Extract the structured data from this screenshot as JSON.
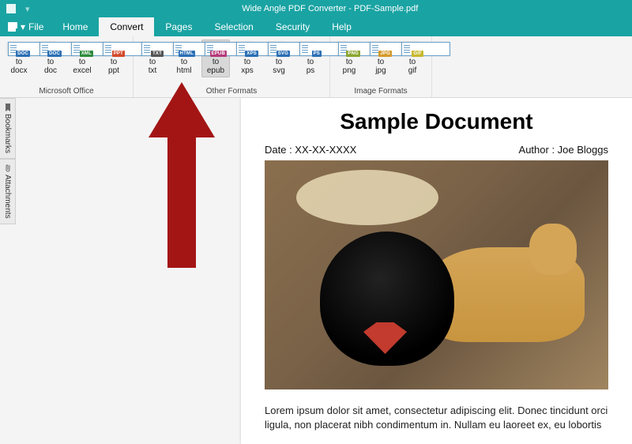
{
  "titlebar": {
    "app_icon": "app-icon",
    "title": "Wide Angle PDF Converter - PDF-Sample.pdf"
  },
  "menubar": {
    "file_label": "File",
    "tabs": [
      {
        "label": "Home"
      },
      {
        "label": "Convert",
        "active": true
      },
      {
        "label": "Pages"
      },
      {
        "label": "Selection"
      },
      {
        "label": "Security"
      },
      {
        "label": "Help"
      }
    ]
  },
  "ribbon": {
    "groups": [
      {
        "label": "Microsoft Office",
        "buttons": [
          {
            "label": "to\ndocx",
            "badge_text": "DOC",
            "badge_color": "#2b6fb5"
          },
          {
            "label": "to\ndoc",
            "badge_text": "DOC",
            "badge_color": "#2b6fb5"
          },
          {
            "label": "to\nexcel",
            "badge_text": "XML",
            "badge_color": "#2e8b3d"
          },
          {
            "label": "to\nppt",
            "badge_text": "PPT",
            "badge_color": "#d24a2b"
          }
        ]
      },
      {
        "label": "Other Formats",
        "buttons": [
          {
            "label": "to\ntxt",
            "badge_text": "TXT",
            "badge_color": "#555"
          },
          {
            "label": "to\nhtml",
            "badge_text": "HTML",
            "badge_color": "#2b6fb5"
          },
          {
            "label": "to\nepub",
            "badge_text": "EPUB",
            "badge_color": "#b53a7a",
            "active": true
          },
          {
            "label": "to\nxps",
            "badge_text": "XPS",
            "badge_color": "#2b6fb5"
          },
          {
            "label": "to\nsvg",
            "badge_text": "SVG",
            "badge_color": "#2b6fb5"
          },
          {
            "label": "to\nps",
            "badge_text": "PS",
            "badge_color": "#2b6fb5"
          }
        ]
      },
      {
        "label": "Image Formats",
        "buttons": [
          {
            "label": "to\npng",
            "badge_text": "PNG",
            "badge_color": "#8aa52e"
          },
          {
            "label": "to\njpg",
            "badge_text": "JPG",
            "badge_color": "#d49a2b"
          },
          {
            "label": "to\ngif",
            "badge_text": "GIF",
            "badge_color": "#c7b82e"
          }
        ]
      }
    ]
  },
  "sidebar": {
    "tabs": [
      {
        "label": "Bookmarks",
        "icon": "bookmark-icon"
      },
      {
        "label": "Attachments",
        "icon": "paperclip-icon"
      }
    ]
  },
  "document": {
    "title": "Sample Document",
    "date_label": "Date : XX-XX-XXXX",
    "author_label": "Author : Joe Bloggs",
    "image_alt": "Two dogs on a rug",
    "body": "Lorem ipsum dolor sit amet, consectetur adipiscing elit. Donec tincidunt orci ligula, non placerat nibh condimentum in. Nullam eu laoreet ex, eu lobortis"
  },
  "annotation": {
    "arrow_color": "#a31515"
  }
}
